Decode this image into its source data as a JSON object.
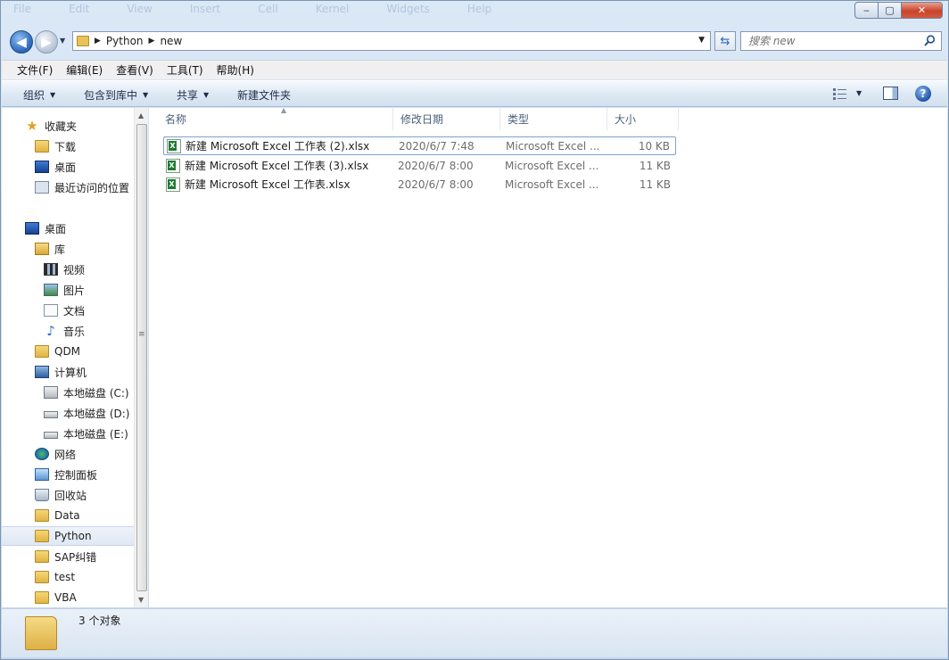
{
  "window": {
    "faint_menu": [
      "File",
      "Edit",
      "View",
      "Insert",
      "Cell",
      "Kernel",
      "Widgets",
      "Help"
    ],
    "caption": {
      "min": "‒",
      "max": "▢",
      "close": "✕"
    }
  },
  "address": {
    "crumbs": [
      "Python",
      "new"
    ],
    "search_placeholder": "搜索 new"
  },
  "menu": [
    "文件(F)",
    "编辑(E)",
    "查看(V)",
    "工具(T)",
    "帮助(H)"
  ],
  "toolbar": {
    "organize": "组织",
    "include_library": "包含到库中",
    "share": "共享",
    "new_folder": "新建文件夹"
  },
  "nav": {
    "favorites": "收藏夹",
    "downloads": "下载",
    "desktop_fav": "桌面",
    "recent": "最近访问的位置",
    "desktop": "桌面",
    "libraries": "库",
    "videos": "视频",
    "pictures": "图片",
    "documents": "文档",
    "music": "音乐",
    "qdm": "QDM",
    "computer": "计算机",
    "drive_c": "本地磁盘 (C:)",
    "drive_d": "本地磁盘 (D:)",
    "drive_e": "本地磁盘 (E:)",
    "network": "网络",
    "control_panel": "控制面板",
    "recycle_bin": "回收站",
    "data": "Data",
    "python": "Python",
    "sap": "SAP纠错",
    "test": "test",
    "vba": "VBA"
  },
  "columns": {
    "name": "名称",
    "date": "修改日期",
    "type": "类型",
    "size": "大小"
  },
  "files": [
    {
      "name": "新建 Microsoft Excel 工作表 (2).xlsx",
      "date": "2020/6/7 7:48",
      "type": "Microsoft Excel ...",
      "size": "10 KB"
    },
    {
      "name": "新建 Microsoft Excel 工作表 (3).xlsx",
      "date": "2020/6/7 8:00",
      "type": "Microsoft Excel ...",
      "size": "11 KB"
    },
    {
      "name": "新建 Microsoft Excel 工作表.xlsx",
      "date": "2020/6/7 8:00",
      "type": "Microsoft Excel ...",
      "size": "11 KB"
    }
  ],
  "status": {
    "count_text": "3 个对象"
  }
}
